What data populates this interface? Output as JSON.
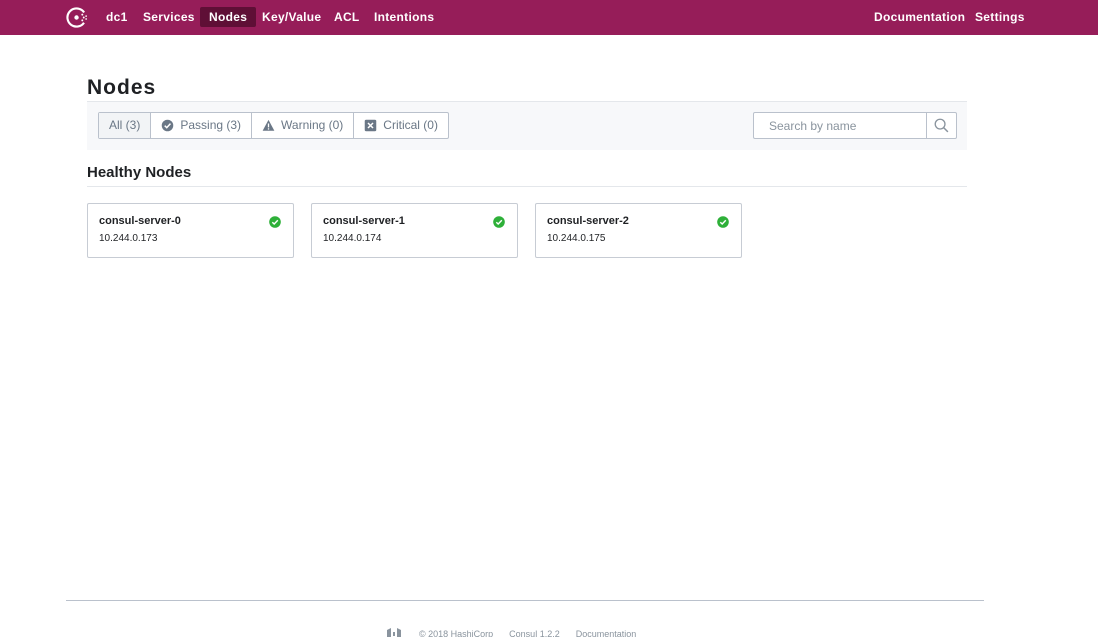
{
  "nav": {
    "datacenter": "dc1",
    "items": [
      {
        "label": "Services"
      },
      {
        "label": "Nodes"
      },
      {
        "label": "Key/Value"
      },
      {
        "label": "ACL"
      },
      {
        "label": "Intentions"
      }
    ],
    "active": "Nodes",
    "right": [
      {
        "label": "Documentation"
      },
      {
        "label": "Settings"
      }
    ]
  },
  "page": {
    "title": "Nodes"
  },
  "filters": {
    "options": [
      {
        "label": "All (3)",
        "icon": "none"
      },
      {
        "label": "Passing (3)",
        "icon": "passing-icon"
      },
      {
        "label": "Warning (0)",
        "icon": "warning-icon"
      },
      {
        "label": "Critical (0)",
        "icon": "critical-icon"
      }
    ],
    "selected": "All (3)"
  },
  "search": {
    "placeholder": "Search by name",
    "value": ""
  },
  "section": {
    "title": "Healthy Nodes"
  },
  "nodes": [
    {
      "name": "consul-server-0",
      "address": "10.244.0.173",
      "status": "passing"
    },
    {
      "name": "consul-server-1",
      "address": "10.244.0.174",
      "status": "passing"
    },
    {
      "name": "consul-server-2",
      "address": "10.244.0.175",
      "status": "passing"
    }
  ],
  "footer": {
    "copyright": "© 2018 HashiCorp",
    "version": "Consul 1.2.2",
    "docs": "Documentation"
  },
  "colors": {
    "brand": "#961d59",
    "nav_active": "#5f0f36",
    "passing": "#2eb039"
  }
}
